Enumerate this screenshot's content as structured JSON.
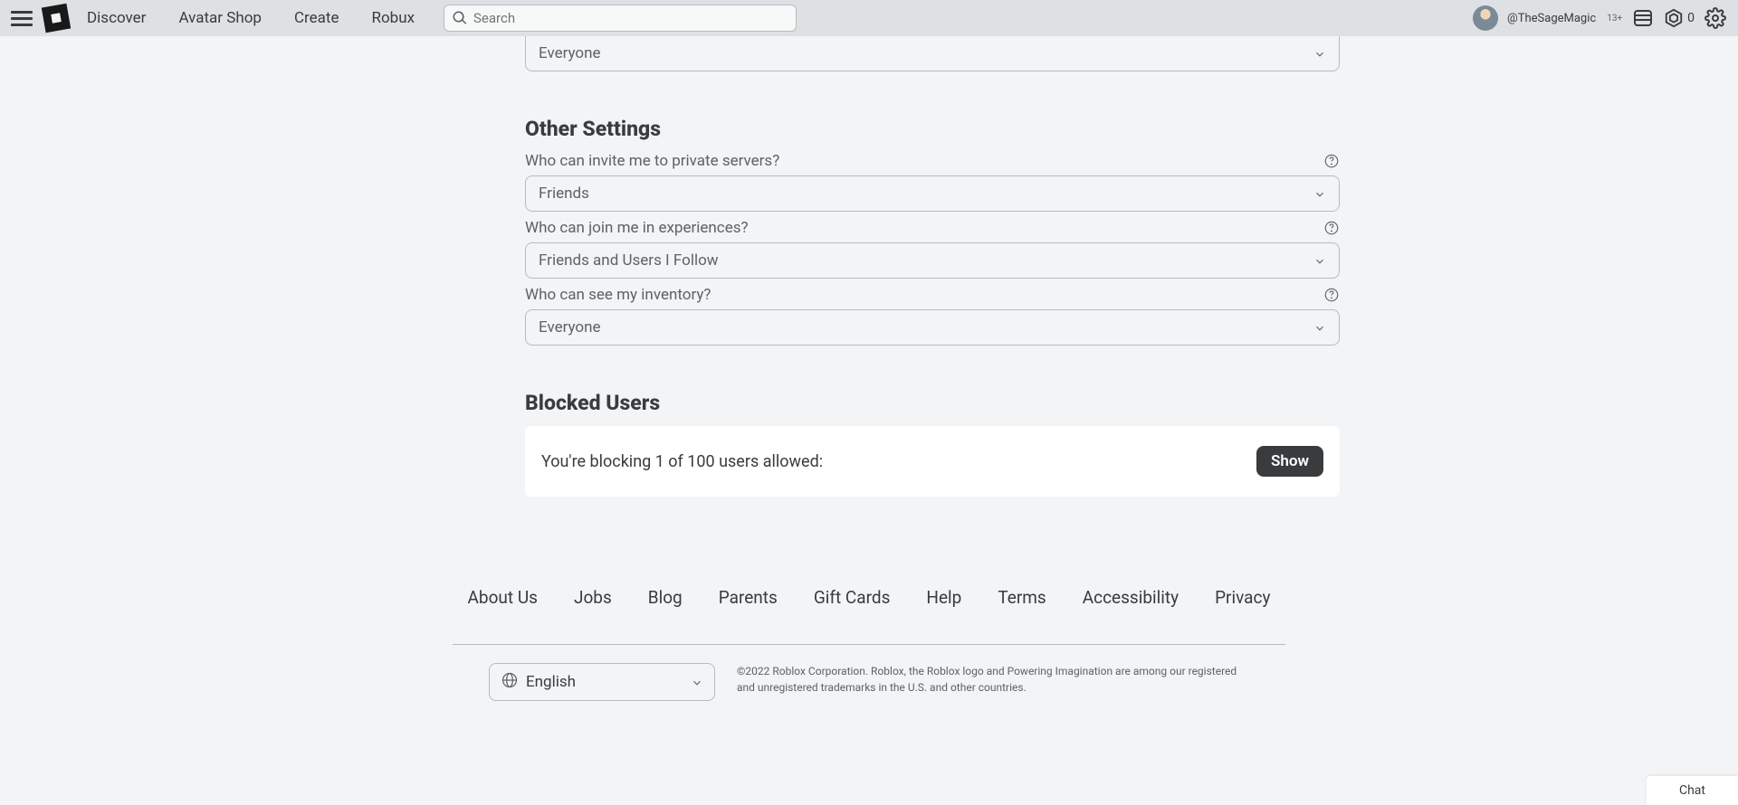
{
  "nav": {
    "links": [
      "Discover",
      "Avatar Shop",
      "Create",
      "Robux"
    ],
    "search_placeholder": "Search",
    "username": "@TheSageMagic",
    "age": "13+",
    "robux": "0"
  },
  "settings": {
    "top_dropdown_value": "Everyone",
    "other_settings_title": "Other Settings",
    "fields": [
      {
        "label": "Who can invite me to private servers?",
        "value": "Friends"
      },
      {
        "label": "Who can join me in experiences?",
        "value": "Friends and Users I Follow"
      },
      {
        "label": "Who can see my inventory?",
        "value": "Everyone"
      }
    ],
    "blocked_title": "Blocked Users",
    "blocked_text": "You're blocking 1 of 100 users allowed:",
    "show_label": "Show"
  },
  "footer": {
    "links": [
      "About Us",
      "Jobs",
      "Blog",
      "Parents",
      "Gift Cards",
      "Help",
      "Terms",
      "Accessibility",
      "Privacy"
    ],
    "language": "English",
    "copyright": "©2022 Roblox Corporation. Roblox, the Roblox logo and Powering Imagination are among our registered and unregistered trademarks in the U.S. and other countries."
  },
  "chat": {
    "label": "Chat"
  }
}
